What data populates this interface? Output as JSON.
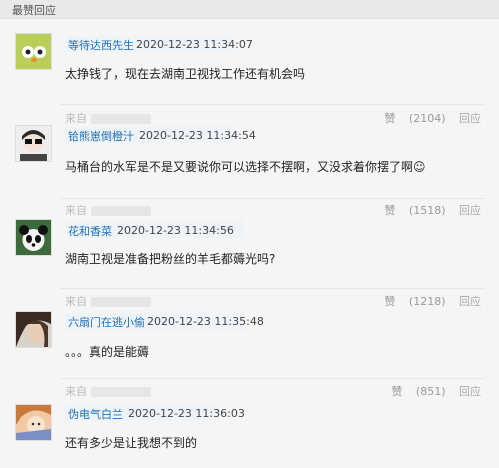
{
  "header": {
    "title": "最赞回应"
  },
  "comments": [
    {
      "username": "等待达西先生",
      "time": "2020-12-23 11:34:07",
      "text": "太挣钱了，现在去湖南卫视找工作还有机会吗",
      "source": "来自",
      "likes": "(2104)",
      "like_label": "赞",
      "reply_label": "回应"
    },
    {
      "username": "铪熊崽倒橙汁",
      "time": "2020-12-23 11:34:54",
      "text": "马桶台的水军是不是又要说你可以选择不摆啊，又没求着你摆了啊☺",
      "source": "来自",
      "likes": "(1518)",
      "like_label": "赞",
      "reply_label": "回应"
    },
    {
      "username": "花和香菜",
      "time": "2020-12-23 11:34:56",
      "text": "湖南卫视是准备把粉丝的羊毛都薅光吗?",
      "source": "来自",
      "likes": "(1218)",
      "like_label": "赞",
      "reply_label": "回应"
    },
    {
      "username": "六扇门在逃小偷",
      "time": "2020-12-23 11:35:48",
      "text": "。。。真的是能薅",
      "source": "来自",
      "likes": "(851)",
      "like_label": "赞",
      "reply_label": "回应"
    },
    {
      "username": "伪电气白兰",
      "time": "2020-12-23 11:36:03",
      "text": "还有多少是让我想不到的"
    }
  ]
}
